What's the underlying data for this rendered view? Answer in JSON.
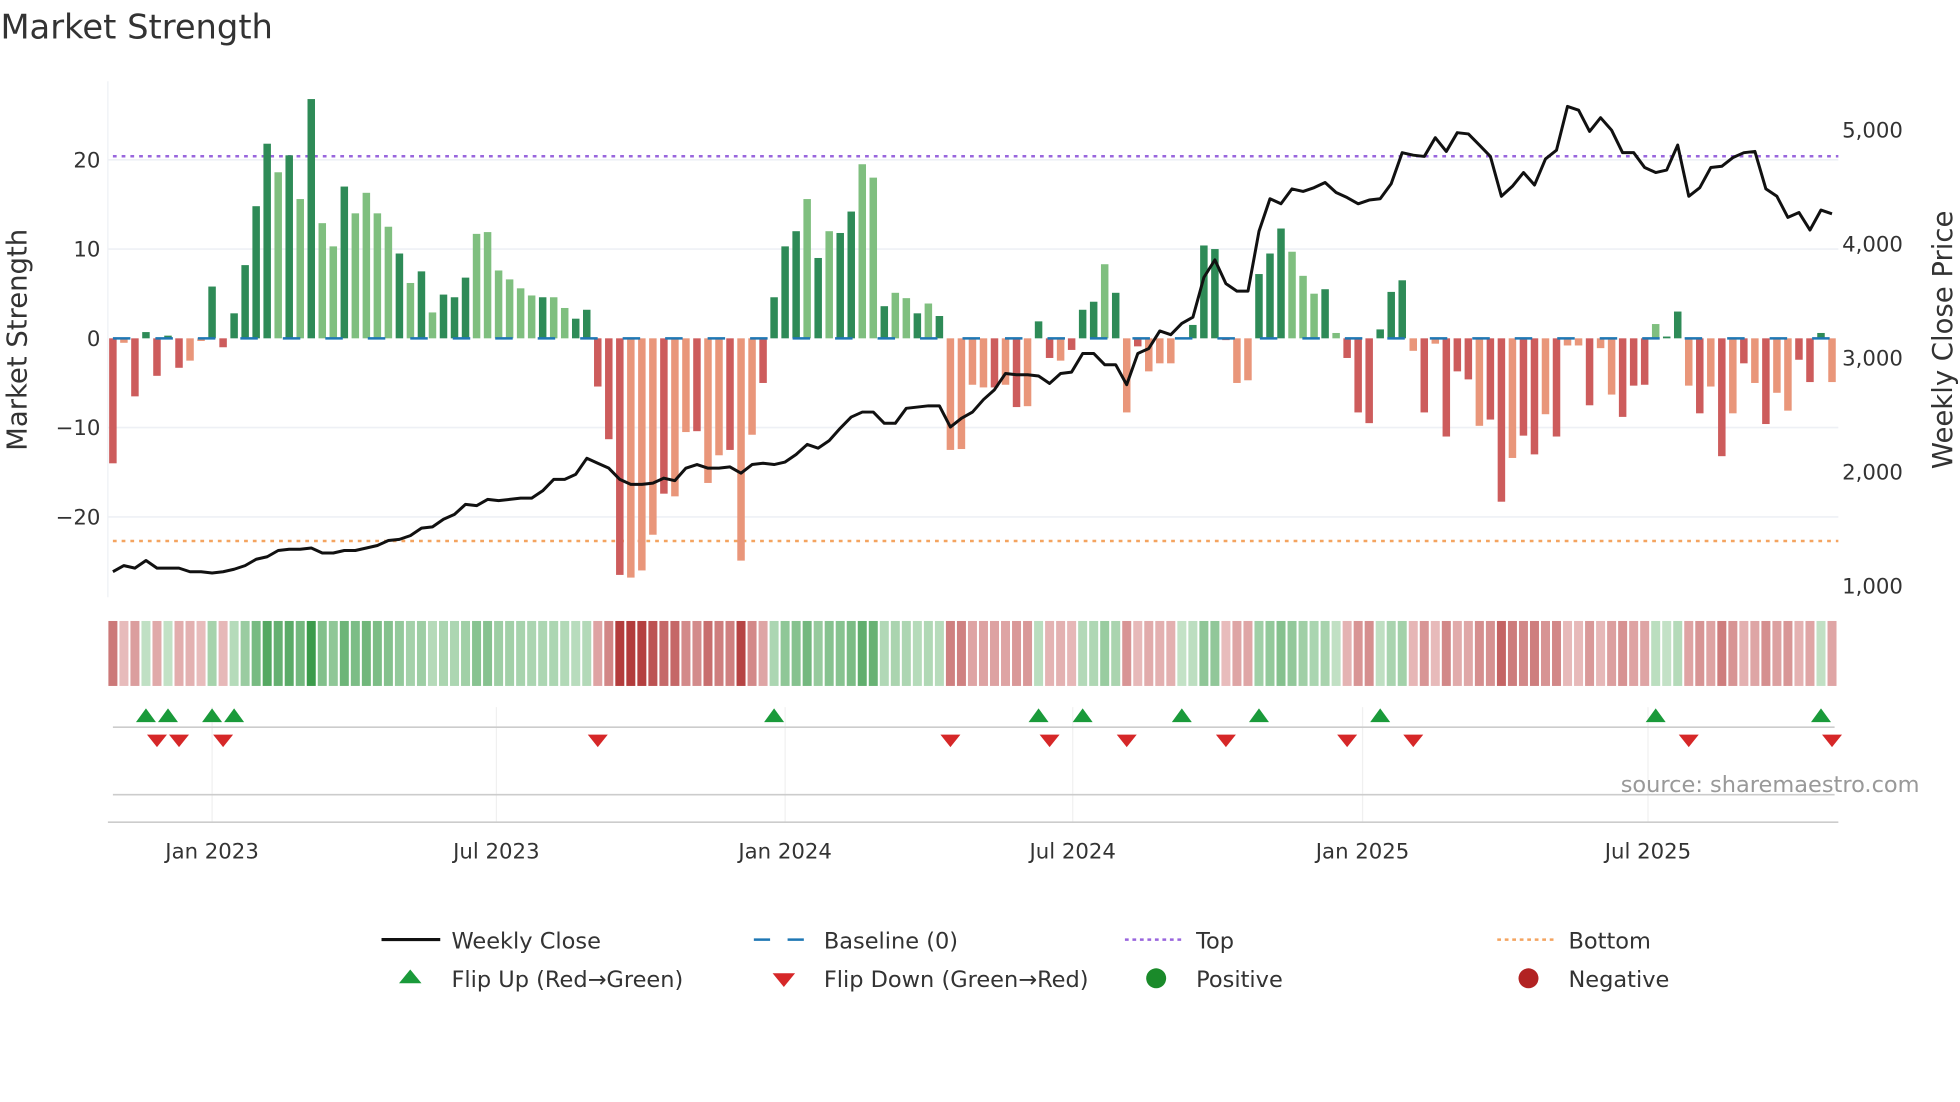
{
  "chart_data": {
    "type": "bar",
    "title": "Market Strength",
    "ylabel": "Market Strength",
    "ylabel_right": "Weekly Close Price",
    "ylim": [
      -29,
      28.8
    ],
    "ylim_right": [
      900,
      5430
    ],
    "yticks": [
      {
        "value": 20,
        "label": "20"
      },
      {
        "value": 10,
        "label": "10"
      },
      {
        "value": 0,
        "label": "0"
      },
      {
        "value": -10,
        "label": "−10"
      },
      {
        "value": -20,
        "label": "−20"
      }
    ],
    "yticks_right": [
      {
        "value": 5000,
        "label": "5,000"
      },
      {
        "value": 4000,
        "label": "4,000"
      },
      {
        "value": 3000,
        "label": "3,000"
      },
      {
        "value": 2000,
        "label": "2,000"
      },
      {
        "value": 1000,
        "label": "1,000"
      }
    ],
    "xticks": [
      {
        "index": 9.0,
        "label": "Jan 2023"
      },
      {
        "index": 34.8,
        "label": "Jul 2023"
      },
      {
        "index": 61.0,
        "label": "Jan 2024"
      },
      {
        "index": 87.1,
        "label": "Jul 2024"
      },
      {
        "index": 113.4,
        "label": "Jan 2025"
      },
      {
        "index": 139.3,
        "label": "Jul 2025"
      }
    ],
    "grid": true,
    "top_level": 20.4,
    "bottom_level": -22.7,
    "strength": [
      -14,
      -0.5,
      -6.5,
      0.7,
      -4.2,
      0.3,
      -3.3,
      -2.5,
      -0.3,
      5.8,
      -1,
      2.8,
      8.2,
      14.8,
      21.8,
      18.6,
      20.5,
      15.6,
      26.8,
      12.9,
      10.3,
      17,
      14,
      16.3,
      14,
      12.5,
      9.5,
      6.2,
      7.5,
      2.9,
      4.9,
      4.6,
      6.8,
      11.7,
      11.9,
      7.6,
      6.6,
      5.6,
      4.8,
      4.6,
      4.6,
      3.4,
      2.2,
      3.2,
      -5.4,
      -11.3,
      -26.5,
      -26.8,
      -26,
      -22,
      -17.4,
      -17.7,
      -10.5,
      -10.4,
      -16.2,
      -13.1,
      -12.5,
      -24.9,
      -10.8,
      -5,
      4.6,
      10.3,
      12,
      15.6,
      9,
      12,
      11.8,
      14.2,
      19.5,
      18,
      3.6,
      5.1,
      4.5,
      2.8,
      3.9,
      2.5,
      -12.5,
      -12.4,
      -5.2,
      -5.5,
      -5.5,
      -5.2,
      -7.7,
      -7.6,
      1.9,
      -2.2,
      -2.5,
      -1.3,
      3.2,
      4.1,
      8.3,
      5.1,
      -8.3,
      -0.9,
      -3.7,
      -2.8,
      -2.8,
      0.1,
      1.5,
      10.4,
      10,
      -0.2,
      -5,
      -4.7,
      7.2,
      9.5,
      12.3,
      9.7,
      7,
      5,
      5.5,
      0.6,
      -2.2,
      -8.3,
      -9.5,
      1,
      5.2,
      6.5,
      -1.4,
      -8.3,
      -0.6,
      -11,
      -3.7,
      -4.6,
      -9.8,
      -9.1,
      -18.3,
      -13.4,
      -10.9,
      -13,
      -8.5,
      -11,
      -0.8,
      -0.8,
      -7.5,
      -1.1,
      -6.3,
      -8.8,
      -5.3,
      -5.2,
      1.6,
      0.2,
      3,
      -5.3,
      -8.4,
      -5.4,
      -13.2,
      -8.4,
      -2.8,
      -5,
      -9.6,
      -6.1,
      -8.1,
      -2.4,
      -4.9,
      0.6,
      -4.9
    ],
    "shade": "dldddddllddddddldldlldlllldldldddlllllldlldddddllldlldlldllddddldlddlldlldldlllldldlddldddldldllldddddlldddllldlddddddldldddlddlddldlldlldddlddldldldldlldddldldddlldd",
    "weekly_close": [
      1124,
      1178,
      1156,
      1222,
      1156,
      1156,
      1156,
      1124,
      1124,
      1113,
      1124,
      1146,
      1178,
      1233,
      1255,
      1310,
      1321,
      1321,
      1332,
      1288,
      1288,
      1310,
      1310,
      1332,
      1354,
      1398,
      1408,
      1441,
      1507,
      1518,
      1584,
      1627,
      1715,
      1704,
      1759,
      1748,
      1759,
      1770,
      1770,
      1835,
      1934,
      1934,
      1978,
      2120,
      2076,
      2033,
      1934,
      1890,
      1890,
      1901,
      1945,
      1923,
      2033,
      2065,
      2033,
      2033,
      2044,
      1989,
      2065,
      2076,
      2065,
      2087,
      2153,
      2241,
      2208,
      2274,
      2383,
      2482,
      2526,
      2526,
      2427,
      2427,
      2558,
      2569,
      2580,
      2580,
      2394,
      2471,
      2526,
      2635,
      2722,
      2865,
      2854,
      2854,
      2843,
      2777,
      2865,
      2876,
      3040,
      3040,
      2941,
      2941,
      2766,
      3040,
      3084,
      3237,
      3204,
      3303,
      3358,
      3708,
      3861,
      3653,
      3587,
      3587,
      4113,
      4398,
      4354,
      4485,
      4463,
      4496,
      4540,
      4453,
      4409,
      4354,
      4387,
      4398,
      4529,
      4803,
      4781,
      4770,
      4934,
      4814,
      4978,
      4967,
      4869,
      4770,
      4420,
      4507,
      4628,
      4518,
      4748,
      4825,
      5208,
      5175,
      4989,
      5110,
      5000,
      4803,
      4803,
      4672,
      4628,
      4650,
      4869,
      4420,
      4496,
      4672,
      4683,
      4759,
      4803,
      4814,
      4485,
      4420,
      4234,
      4277,
      4124,
      4299,
      4266
    ],
    "flip_up": [
      3,
      5,
      9,
      11,
      60,
      84,
      88,
      97,
      104,
      115,
      140,
      155
    ],
    "flip_down": [
      4,
      6,
      10,
      44,
      76,
      85,
      92,
      101,
      112,
      118,
      143,
      156
    ],
    "legend": {
      "placement": "bottom",
      "weekly_close": "Weekly Close",
      "baseline": "Baseline (0)",
      "top": "Top",
      "bottom": "Bottom",
      "flip_up": "Flip Up (Red→Green)",
      "flip_down": "Flip Down (Green→Red)",
      "positive": "Positive",
      "negative": "Negative"
    },
    "source": "source: sharemaestro.com"
  },
  "colors": {
    "pos_strong": "#2e8b57",
    "pos_weak": "#7fbf7f",
    "neg_strong": "#cd5c5c",
    "neg_weak": "#e9967a",
    "line": "#111111",
    "baseline": "#1f77b4",
    "top": "#9966dd",
    "bottom": "#f4a460",
    "flip_up": "#1a9a3a",
    "flip_down": "#d62728",
    "positive": "#1a8a2a",
    "negative": "#b22222"
  }
}
